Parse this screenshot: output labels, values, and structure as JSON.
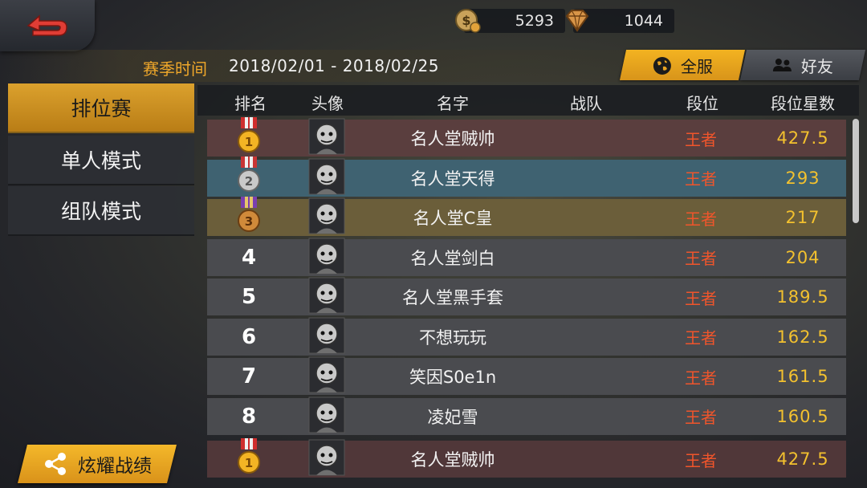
{
  "currencies": {
    "coins": "5293",
    "gems": "1044"
  },
  "season": {
    "label": "赛季时间",
    "range": "2018/02/01 - 2018/02/25"
  },
  "scope_tabs": {
    "all": "全服",
    "friends": "好友"
  },
  "menu": {
    "ranked": "排位赛",
    "solo": "单人模式",
    "team": "组队模式"
  },
  "table": {
    "headers": {
      "rank": "排名",
      "avatar": "头像",
      "name": "名字",
      "team": "战队",
      "tier": "段位",
      "stars": "段位星数"
    },
    "rows": [
      {
        "rank": "1",
        "medal": "gold",
        "name": "名人堂贼帅",
        "team": "",
        "tier": "王者",
        "stars": "427.5"
      },
      {
        "rank": "2",
        "medal": "silver",
        "name": "名人堂天得",
        "team": "",
        "tier": "王者",
        "stars": "293"
      },
      {
        "rank": "3",
        "medal": "bronze",
        "name": "名人堂C皇",
        "team": "",
        "tier": "王者",
        "stars": "217"
      },
      {
        "rank": "4",
        "medal": "",
        "name": "名人堂剑白",
        "team": "",
        "tier": "王者",
        "stars": "204"
      },
      {
        "rank": "5",
        "medal": "",
        "name": "名人堂黑手套",
        "team": "",
        "tier": "王者",
        "stars": "189.5"
      },
      {
        "rank": "6",
        "medal": "",
        "name": "不想玩玩",
        "team": "",
        "tier": "王者",
        "stars": "162.5"
      },
      {
        "rank": "7",
        "medal": "",
        "name": "笑因S0e1n",
        "team": "",
        "tier": "王者",
        "stars": "161.5"
      },
      {
        "rank": "8",
        "medal": "",
        "name": "凌妃雪",
        "team": "",
        "tier": "王者",
        "stars": "160.5"
      }
    ],
    "my_row": {
      "rank": "1",
      "medal": "gold",
      "name": "名人堂贼帅",
      "team": "",
      "tier": "王者",
      "stars": "427.5"
    }
  },
  "share": {
    "label": "炫耀战绩"
  },
  "icons": {
    "back": "back-arrow-icon",
    "coin": "coin-icon",
    "gem": "diamond-icon",
    "globe": "globe-icon",
    "friends": "friends-icon",
    "share": "share-icon",
    "medal": "medal-icon",
    "avatar": "avatar-icon"
  },
  "colors": {
    "accent": "#f2ad24",
    "tier": "#f0552b",
    "stars": "#f3c12e",
    "row1": "#5a3e3e",
    "row2": "#3f6271",
    "row3": "#6b5e3a",
    "row_default": "#4a4b4f",
    "my_row": "#503739"
  }
}
